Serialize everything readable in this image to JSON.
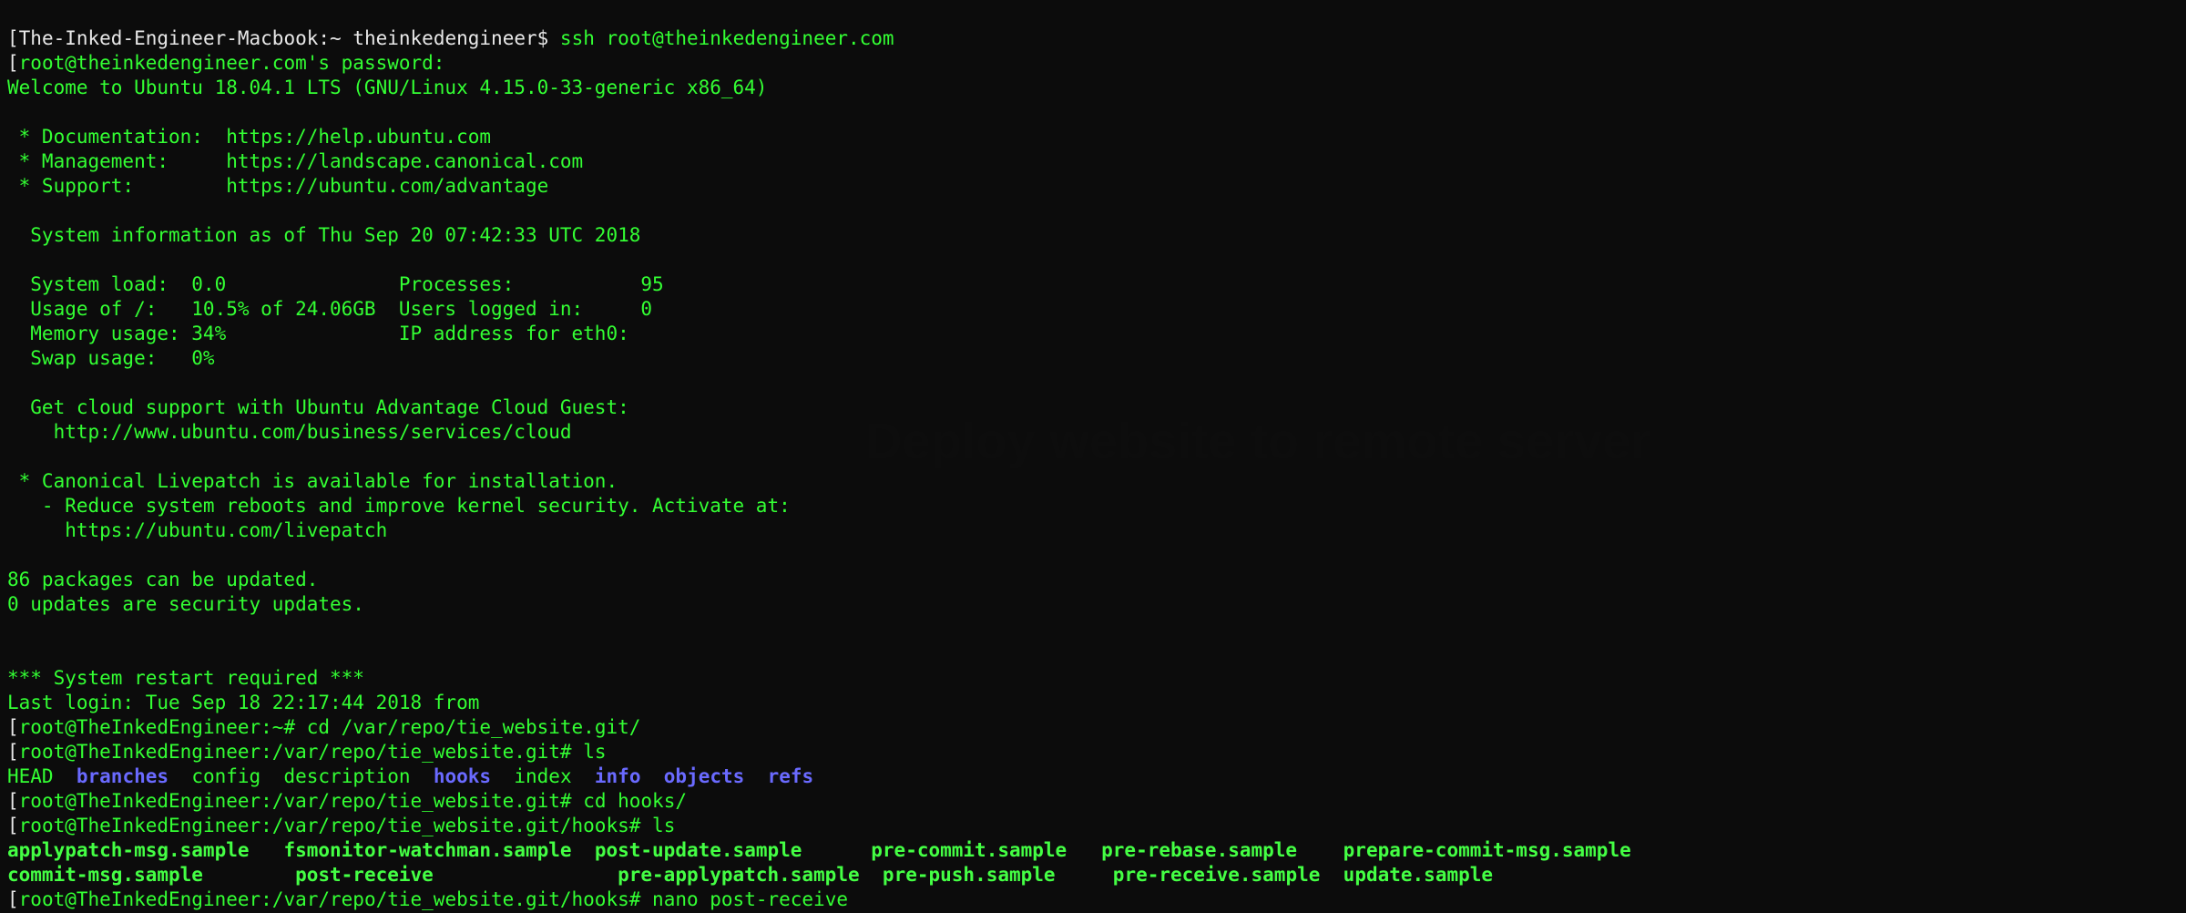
{
  "mac_prompt_host": "The-Inked-Engineer-Macbook:~",
  "mac_prompt_user": "theinkedengineer$",
  "ssh_cmd": "ssh root@theinkedengineer.com",
  "pw_line": "root@theinkedengineer.com's password:",
  "welcome": "Welcome to Ubuntu 18.04.1 LTS (GNU/Linux 4.15.0-33-generic x86_64)",
  "doc_label": " * Documentation:  ",
  "doc_url": "https://help.ubuntu.com",
  "mgmt_label": " * Management:     ",
  "mgmt_url": "https://landscape.canonical.com",
  "sup_label": " * Support:        ",
  "sup_url": "https://ubuntu.com/advantage",
  "sysinfo_header": "  System information as of Thu Sep 20 07:42:33 UTC 2018",
  "sys_l1": "  System load:  0.0               Processes:           95",
  "sys_l2": "  Usage of /:   10.5% of 24.06GB  Users logged in:     0",
  "sys_l3": "  Memory usage: 34%               IP address for eth0:",
  "sys_l4": "  Swap usage:   0%",
  "cloud1": "  Get cloud support with Ubuntu Advantage Cloud Guest:",
  "cloud2": "    http://www.ubuntu.com/business/services/cloud",
  "live1": " * Canonical Livepatch is available for installation.",
  "live2": "   - Reduce system reboots and improve kernel security. Activate at:",
  "live3": "     https://ubuntu.com/livepatch",
  "pkg1": "86 packages can be updated.",
  "pkg2": "0 updates are security updates.",
  "restart": "*** System restart required ***",
  "lastlogin": "Last login: Tue Sep 18 22:17:44 2018 from",
  "p_home": "root@TheInkedEngineer:~#",
  "p_repo": "root@TheInkedEngineer:/var/repo/tie_website.git#",
  "p_hooks": "root@TheInkedEngineer:/var/repo/tie_website.git/hooks#",
  "cmd_cd_repo": "cd /var/repo/tie_website.git/",
  "cmd_ls": "ls",
  "cmd_cd_hooks": "cd hooks/",
  "cmd_nano": "nano post-receive",
  "ls_repo": {
    "head": "HEAD",
    "branches": "branches",
    "config": "config",
    "description": "description",
    "hooks": "hooks",
    "index": "index",
    "info": "info",
    "objects": "objects",
    "refs": "refs"
  },
  "ls_hooks_row1": {
    "c1": "applypatch-msg.sample",
    "c2": "fsmonitor-watchman.sample",
    "c3": "post-update.sample",
    "c4": "pre-commit.sample",
    "c5": "pre-rebase.sample",
    "c6": "prepare-commit-msg.sample"
  },
  "ls_hooks_row2": {
    "c1": "commit-msg.sample",
    "c2": "post-receive",
    "c3": "pre-applypatch.sample",
    "c4": "pre-push.sample",
    "c5": "pre-receive.sample",
    "c6": "update.sample"
  },
  "ghost_title": "Deploy website to remote server"
}
